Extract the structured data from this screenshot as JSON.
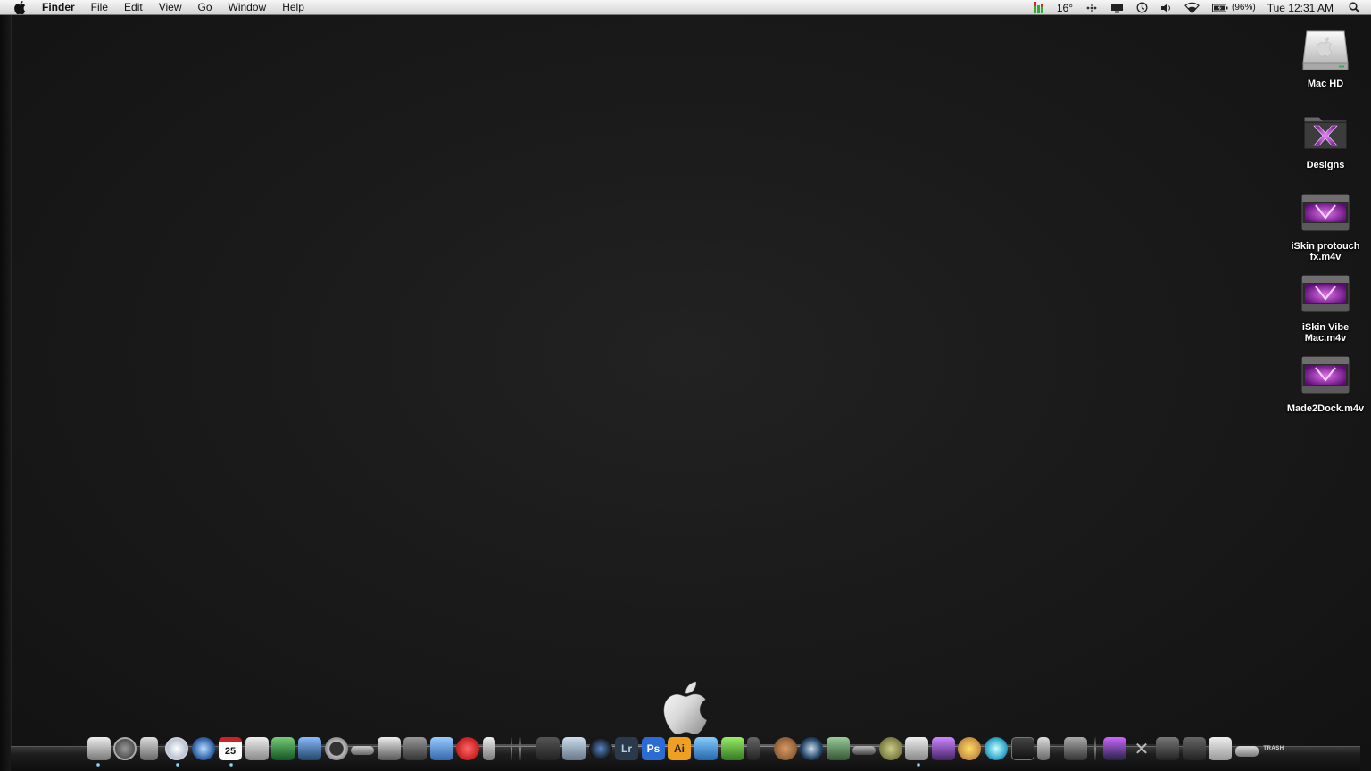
{
  "menubar": {
    "app_name": "Finder",
    "menus": [
      "File",
      "Edit",
      "View",
      "Go",
      "Window",
      "Help"
    ],
    "status": {
      "temperature": "16°",
      "battery_percent": "(96%)",
      "clock": "Tue 12:31 AM"
    }
  },
  "desktop_icons": [
    {
      "label": "Mac HD",
      "icon": "hard-drive-icon"
    },
    {
      "label": "Designs",
      "icon": "folder-icon"
    },
    {
      "label": "iSkin protouch fx.m4v",
      "icon": "video-file-icon"
    },
    {
      "label": "iSkin Vibe Mac.m4v",
      "icon": "video-file-icon"
    },
    {
      "label": "Made2Dock.m4v",
      "icon": "video-file-icon"
    }
  ],
  "dock": {
    "calendar_day": "25",
    "lightroom_label": "Lr",
    "photoshop_label": "Ps",
    "illustrator_label": "Ai",
    "trash_label": "TRASH"
  },
  "colors": {
    "desktop_bg": "#1a1a1a",
    "menubar_bg": "#e4e4e4",
    "accent_purple": "#b43cd2",
    "photoshop_blue": "#2b6bd4",
    "illustrator_orange": "#f0a020"
  }
}
